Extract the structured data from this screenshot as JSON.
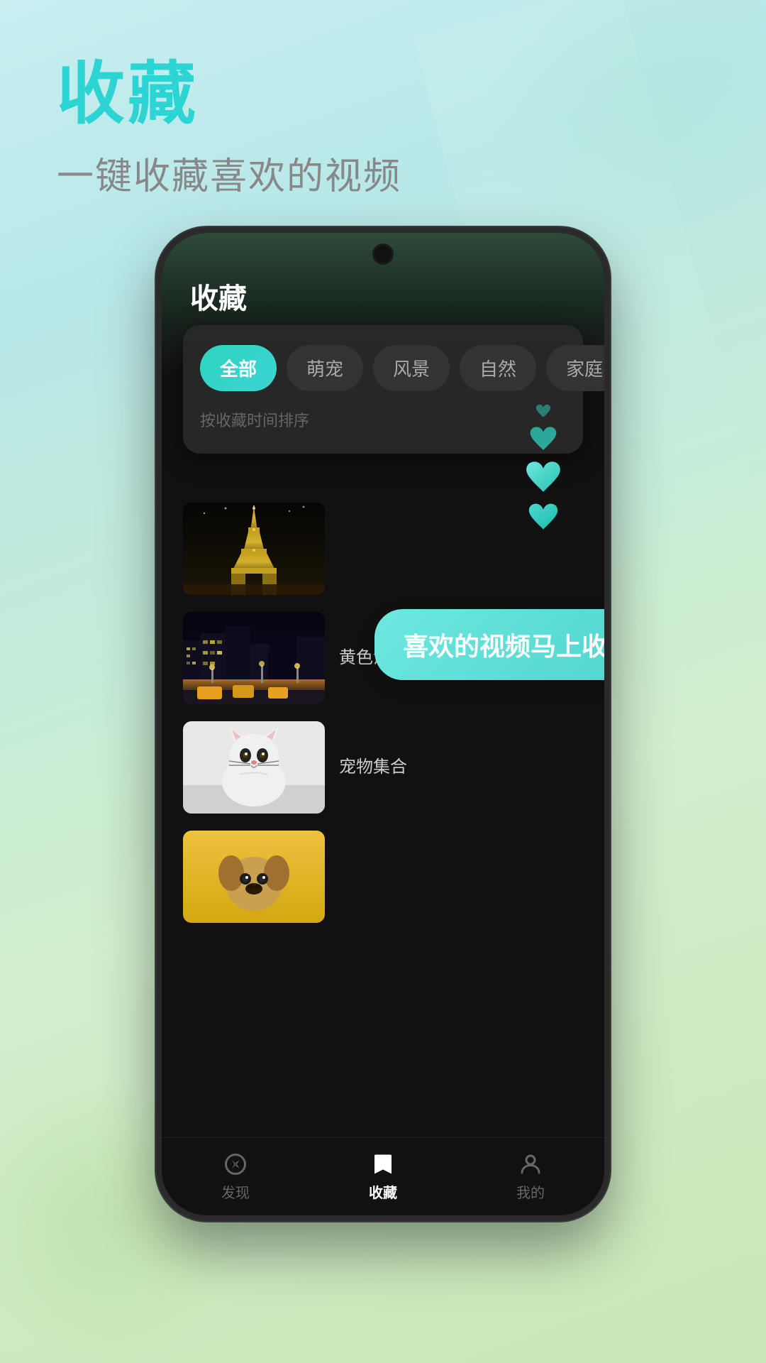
{
  "page": {
    "background": "linear-gradient(160deg, #c8eef0 0%, #b8e8e8 20%, #d0eecc 60%, #c8e8b8 100%)"
  },
  "header": {
    "main_title": "收藏",
    "sub_title": "一键收藏喜欢的视频"
  },
  "phone": {
    "screen_title": "收藏"
  },
  "categories": {
    "items": [
      {
        "label": "全部",
        "active": true
      },
      {
        "label": "萌宠",
        "active": false
      },
      {
        "label": "风景",
        "active": false
      },
      {
        "label": "自然",
        "active": false
      },
      {
        "label": "家庭",
        "active": false
      }
    ],
    "sort_label": "按收藏时间排序"
  },
  "video_list": [
    {
      "title": "",
      "thumb_type": "eiffel"
    },
    {
      "title": "黄色法拉...",
      "thumb_type": "city"
    },
    {
      "title": "宠物集合",
      "thumb_type": "cat"
    },
    {
      "title": "",
      "thumb_type": "dog"
    }
  ],
  "tooltip": {
    "text": "喜欢的视频马上收藏"
  },
  "bottom_nav": {
    "items": [
      {
        "label": "发现",
        "active": false,
        "icon": "compass"
      },
      {
        "label": "收藏",
        "active": true,
        "icon": "bookmark"
      },
      {
        "label": "我的",
        "active": false,
        "icon": "person"
      }
    ]
  },
  "hearts": {
    "colors": [
      "#2dd4bf",
      "#4dd4cc",
      "#3eccc0",
      "#2abfb0"
    ]
  }
}
